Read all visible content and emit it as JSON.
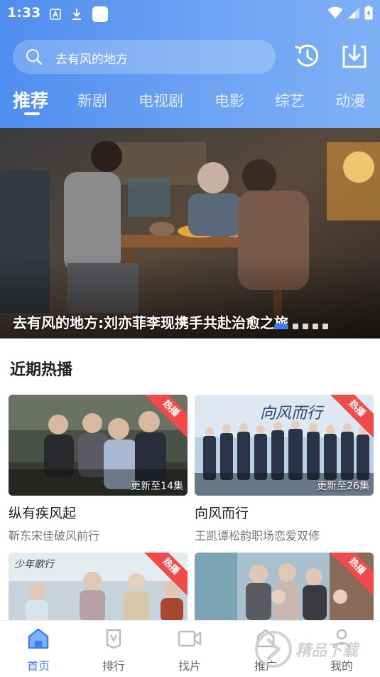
{
  "status_bar": {
    "time": "1:33"
  },
  "search": {
    "placeholder": "去有风的地方"
  },
  "tabs": [
    {
      "label": "推荐",
      "active": true
    },
    {
      "label": "新剧"
    },
    {
      "label": "电视剧"
    },
    {
      "label": "电影"
    },
    {
      "label": "综艺"
    },
    {
      "label": "动漫"
    }
  ],
  "banner": {
    "caption": "去有风的地方:刘亦菲李现携手共赴治愈之旅"
  },
  "recent": {
    "title": "近期热播",
    "cards": [
      {
        "title": "纵有疾风起",
        "subtitle": "靳东宋佳破风前行",
        "badge": "热播",
        "update": "更新至14集"
      },
      {
        "title": "向风而行",
        "subtitle": "王凯谭松韵职场恋爱双修",
        "badge": "热播",
        "update": "更新至26集",
        "poster_text": "向风而行"
      },
      {
        "title": "",
        "subtitle": "",
        "badge": "热播",
        "poster_text": "少年歌行"
      },
      {
        "title": "",
        "subtitle": "",
        "badge": "热播"
      }
    ]
  },
  "bottom_nav": [
    {
      "label": "首页",
      "icon": "home-icon",
      "active": true
    },
    {
      "label": "排行",
      "icon": "ranking-icon"
    },
    {
      "label": "找片",
      "icon": "video-icon"
    },
    {
      "label": "推广",
      "icon": "promote-icon"
    },
    {
      "label": "我的",
      "icon": "profile-icon"
    }
  ],
  "watermark": {
    "text": "精品下载"
  },
  "colors": {
    "accent": "#3d7ff0",
    "header_gradient_start": "#4f8df0",
    "hot_badge": "#f04a4a"
  }
}
